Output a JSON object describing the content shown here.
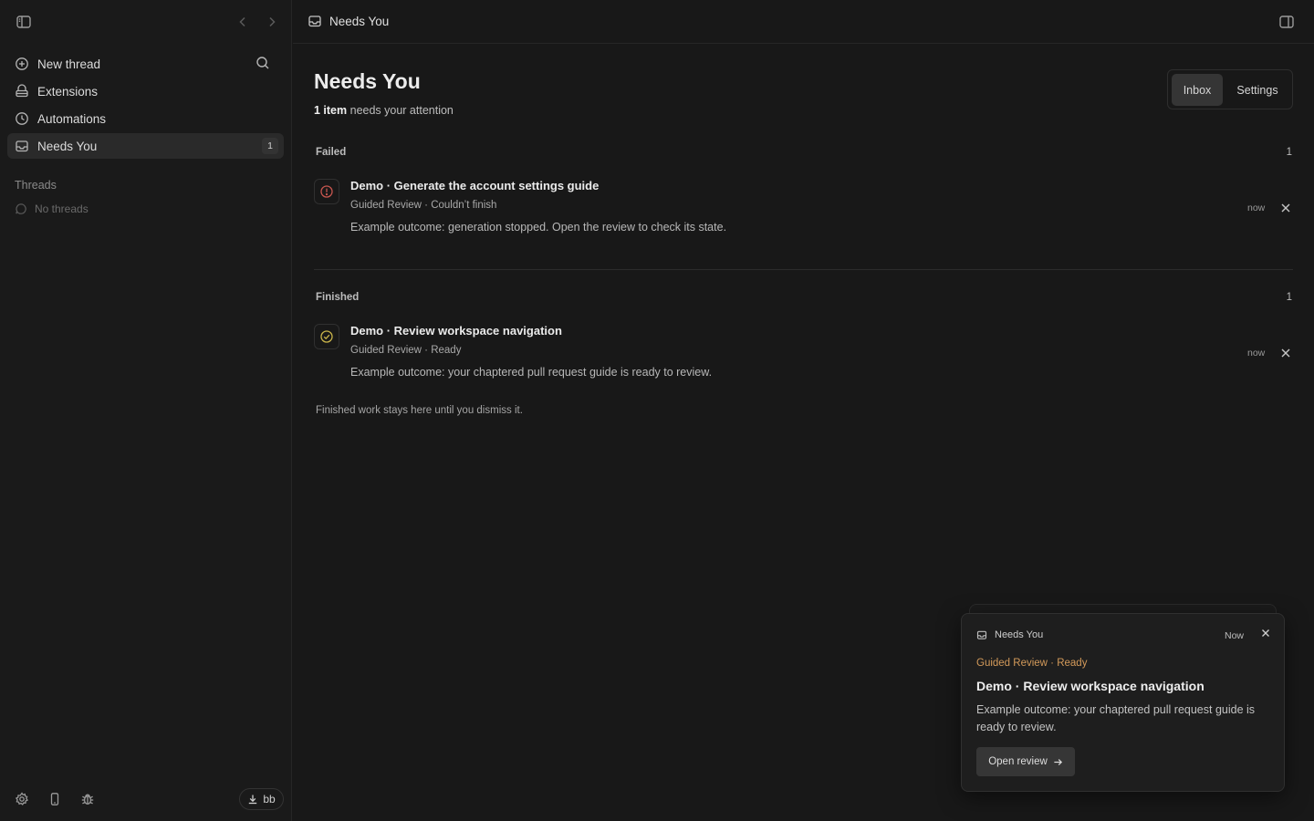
{
  "colors": {
    "background": "#181818",
    "sidebar": "#1a1a1a",
    "accent_orange": "#d39a5a",
    "failed_red": "#c7564f",
    "finished_yellow": "#c9b44a"
  },
  "sidebar": {
    "items": [
      {
        "label": "New thread",
        "icon": "plus-circle-icon"
      },
      {
        "label": "Extensions",
        "icon": "extensions-icon"
      },
      {
        "label": "Automations",
        "icon": "clock-icon"
      },
      {
        "label": "Needs You",
        "icon": "inbox-icon",
        "badge": "1"
      }
    ],
    "section_label": "Threads",
    "empty_text": "No threads",
    "download_label": "bb"
  },
  "header": {
    "title": "Needs You"
  },
  "page": {
    "title": "Needs You",
    "subtitle_count": "1 item",
    "subtitle_rest": " needs your attention",
    "tabs": [
      "Inbox",
      "Settings"
    ],
    "footnote": "Finished work stays here until you dismiss it."
  },
  "groups": {
    "failed": {
      "label": "Failed",
      "count": "1",
      "item": {
        "title": "Demo · Generate the account settings guide",
        "meta": "Guided Review · Couldn’t finish",
        "body": "Example outcome: generation stopped. Open the review to check its state.",
        "time": "now"
      }
    },
    "finished": {
      "label": "Finished",
      "count": "1",
      "item": {
        "title": "Demo · Review workspace navigation",
        "meta": "Guided Review · Ready",
        "body": "Example outcome: your chaptered pull request guide is ready to review.",
        "time": "now"
      }
    }
  },
  "toast": {
    "header": "Needs You",
    "time": "Now",
    "kicker": "Guided Review · Ready",
    "title": "Demo · Review workspace navigation",
    "body": "Example outcome: your chaptered pull request guide is ready to review.",
    "button": "Open review"
  }
}
